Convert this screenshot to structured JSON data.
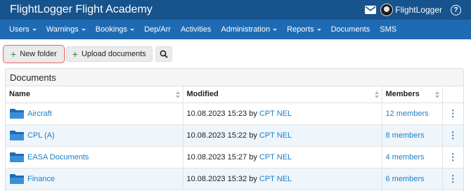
{
  "header": {
    "brand": "FlightLogger Flight Academy",
    "user_name": "FlightLogger",
    "mail_icon": "mail-icon",
    "avatar_icon": "avatar",
    "help_icon": "help-icon",
    "help_glyph": "?"
  },
  "nav": {
    "items": [
      {
        "label": "Users",
        "dropdown": true
      },
      {
        "label": "Warnings",
        "dropdown": true
      },
      {
        "label": "Bookings",
        "dropdown": true
      },
      {
        "label": "Dep/Arr",
        "dropdown": false
      },
      {
        "label": "Activities",
        "dropdown": false
      },
      {
        "label": "Administration",
        "dropdown": true
      },
      {
        "label": "Reports",
        "dropdown": true
      },
      {
        "label": "Documents",
        "dropdown": false
      },
      {
        "label": "SMS",
        "dropdown": false
      }
    ]
  },
  "toolbar": {
    "new_folder": "New folder",
    "upload_documents": "Upload documents",
    "plus_glyph": "+",
    "search_icon": "search-icon"
  },
  "documents": {
    "title": "Documents",
    "columns": {
      "name": "Name",
      "modified": "Modified",
      "members": "Members"
    },
    "rows": [
      {
        "name": "Aircraft",
        "date": "10.08.2023 15:23",
        "by_label": "by",
        "author": "CPT NEL",
        "members": "12 members"
      },
      {
        "name": "CPL (A)",
        "date": "10.08.2023 15:22",
        "by_label": "by",
        "author": "CPT NEL",
        "members": "8 members"
      },
      {
        "name": "EASA Documents",
        "date": "10.08.2023 15:27",
        "by_label": "by",
        "author": "CPT NEL",
        "members": "4 members"
      },
      {
        "name": "Finance",
        "date": "10.08.2023 15:32",
        "by_label": "by",
        "author": "CPT NEL",
        "members": "6 members"
      }
    ],
    "row_menu_glyph": "⋮"
  },
  "colors": {
    "topbar": "#17538c",
    "navbar": "#1f6bb3",
    "link": "#1e7fc4",
    "folder": "#2a78c4",
    "highlight": "#e0574d",
    "alt_row": "#eef5fb"
  }
}
